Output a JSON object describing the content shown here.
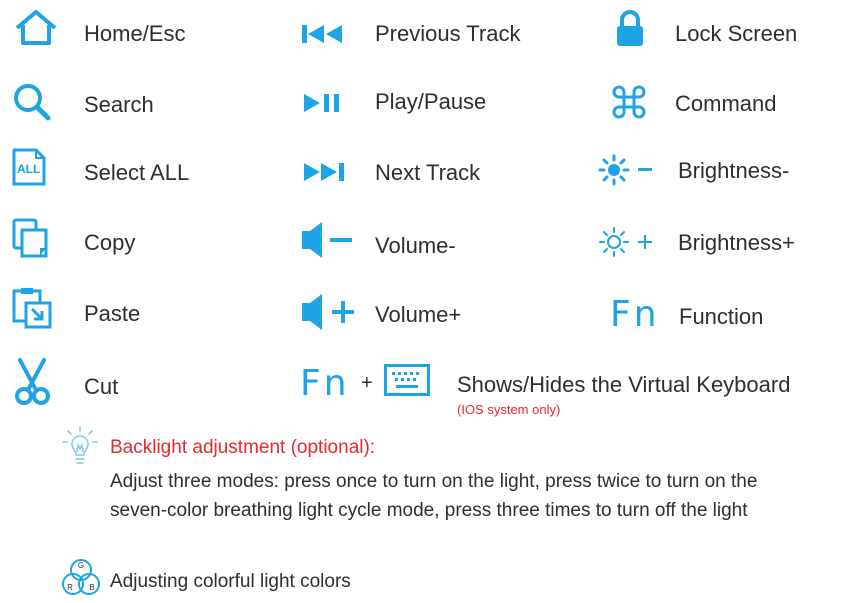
{
  "accent_color": "#1ea4e4",
  "warning_color": "#e6282d",
  "col1": [
    {
      "label": "Home/Esc",
      "icon": "home-icon"
    },
    {
      "label": "Search",
      "icon": "search-icon"
    },
    {
      "label": "Select ALL",
      "icon": "select-all-icon",
      "icon_text": "ALL"
    },
    {
      "label": "Copy",
      "icon": "copy-icon"
    },
    {
      "label": "Paste",
      "icon": "paste-icon"
    },
    {
      "label": "Cut",
      "icon": "scissors-icon"
    }
  ],
  "col2": [
    {
      "label": "Previous Track",
      "icon": "previous-track-icon"
    },
    {
      "label": "Play/Pause",
      "icon": "play-pause-icon"
    },
    {
      "label": "Next Track",
      "icon": "next-track-icon"
    },
    {
      "label": "Volume-",
      "icon": "volume-down-icon"
    },
    {
      "label": "Volume+",
      "icon": "volume-up-icon"
    }
  ],
  "col3": [
    {
      "label": "Lock Screen",
      "icon": "lock-icon"
    },
    {
      "label": "Command",
      "icon": "command-icon"
    },
    {
      "label": "Brightness-",
      "icon": "brightness-down-icon"
    },
    {
      "label": "Brightness+",
      "icon": "brightness-up-icon"
    },
    {
      "label": "Function",
      "icon": "fn-icon",
      "icon_text": "Fn"
    }
  ],
  "virtual_keyboard": {
    "fn_text": "Fn",
    "plus": "+",
    "label": "Shows/Hides the Virtual Keyboard",
    "note": "(IOS system only)"
  },
  "backlight": {
    "title": "Backlight adjustment (optional):",
    "body": "Adjust three modes: press once to turn on the light, press twice to turn on the seven-color breathing light cycle mode, press three times to turn off the light",
    "rgb_label": "Adjusting colorful light colors",
    "rgb_letters": [
      "G",
      "R",
      "B"
    ]
  }
}
